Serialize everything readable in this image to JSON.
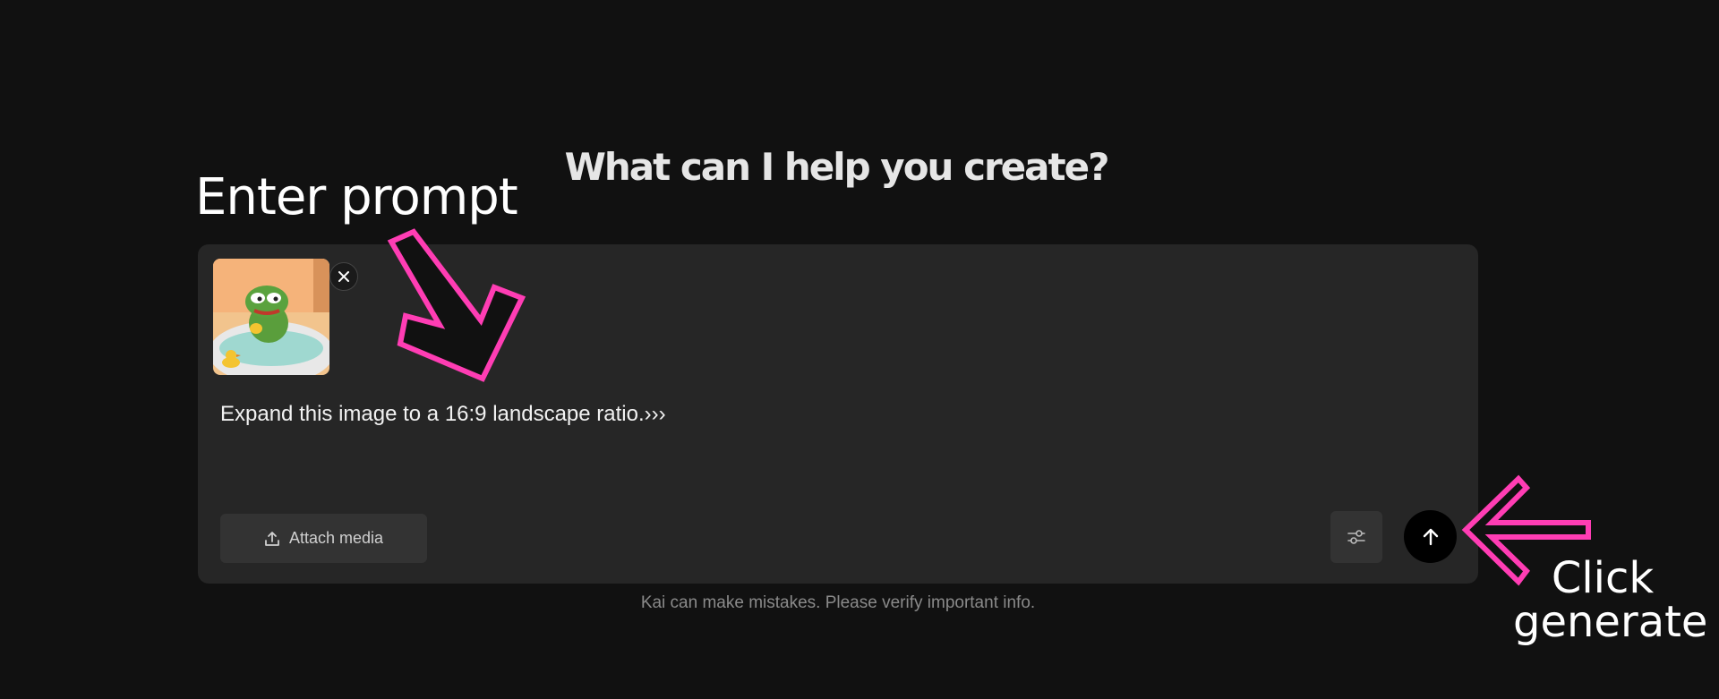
{
  "headline": "What can I help you create?",
  "annotations": {
    "enter_prompt": "Enter prompt",
    "click_generate_line1": "Click",
    "click_generate_line2": "generate",
    "arrow_color": "#ff3db4"
  },
  "composer": {
    "attachment": {
      "image_alt": "frog in bathtub with rubber duck",
      "remove_icon": "close-icon"
    },
    "prompt_text": "Expand this image to a 16:9 landscape ratio.›››",
    "attach_label": "Attach media",
    "attach_icon": "upload-icon",
    "settings_icon": "sliders-icon",
    "send_icon": "arrow-up-icon"
  },
  "disclaimer": "Kai can make mistakes. Please verify important info."
}
